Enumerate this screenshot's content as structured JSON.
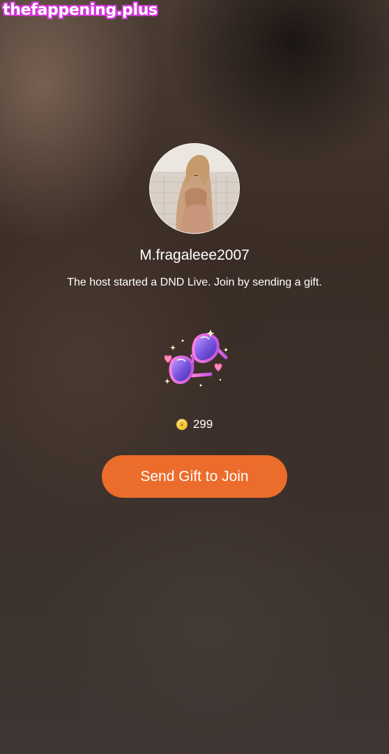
{
  "watermark": "thefappening.plus",
  "host": {
    "username": "M.fragaleee2007",
    "message": "The host started a DND Live. Join by sending a gift.",
    "avatar_icon": "profile-photo"
  },
  "gift": {
    "icon": "heart-sunglasses-icon",
    "price": "299",
    "currency_icon": "coin-icon"
  },
  "actions": {
    "send_label": "Send Gift to Join"
  },
  "colors": {
    "button": "#ec6c2b",
    "watermark_outline": "#d23ad8",
    "coin": "#f3c431"
  }
}
